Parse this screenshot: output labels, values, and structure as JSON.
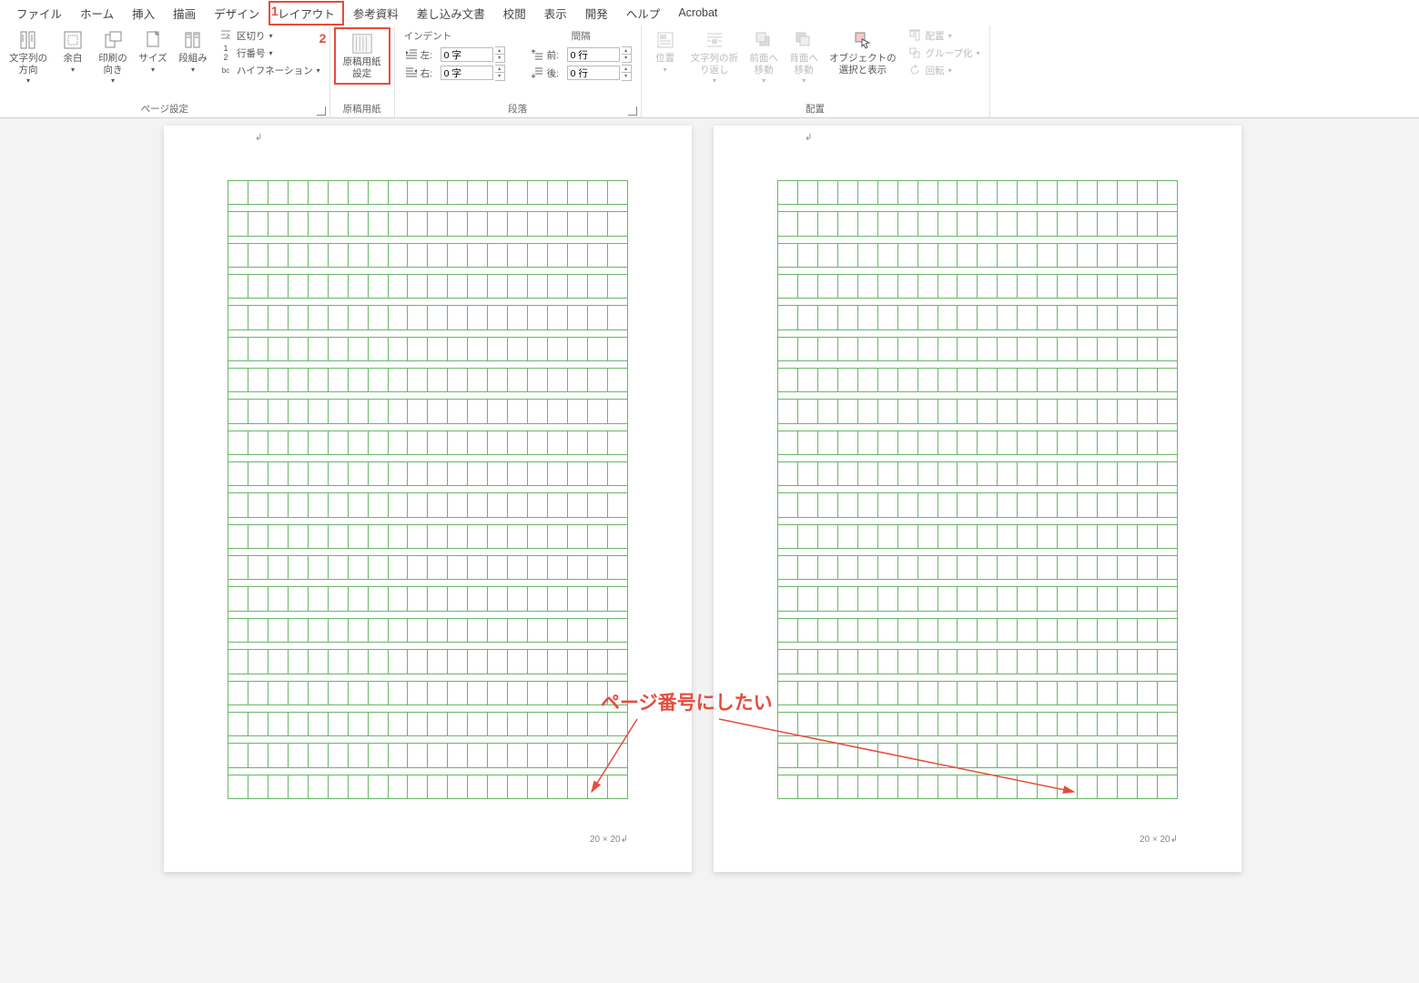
{
  "menu": {
    "file": "ファイル",
    "home": "ホーム",
    "insert": "挿入",
    "draw": "描画",
    "design": "デザイン",
    "layout": "レイアウト",
    "references": "参考資料",
    "mailings": "差し込み文書",
    "review": "校閲",
    "view": "表示",
    "developer": "開発",
    "help": "ヘルプ",
    "acrobat": "Acrobat"
  },
  "callouts": {
    "one": "1",
    "two": "2"
  },
  "ribbon": {
    "page_setup": {
      "label": "ページ設定",
      "text_direction": "文字列の\n方向",
      "margins": "余白",
      "orientation": "印刷の\n向き",
      "size": "サイズ",
      "columns": "段組み",
      "breaks": "区切り",
      "line_numbers": "行番号",
      "hyphenation": "ハイフネーション"
    },
    "genko": {
      "label": "原稿用紙",
      "button": "原稿用紙\n設定"
    },
    "paragraph": {
      "label": "段落",
      "indent_header": "インデント",
      "spacing_header": "間隔",
      "left_label": "左:",
      "right_label": "右:",
      "before_label": "前:",
      "after_label": "後:",
      "left_value": "0 字",
      "right_value": "0 字",
      "before_value": "0 行",
      "after_value": "0 行"
    },
    "arrange": {
      "label": "配置",
      "position": "位置",
      "wrap": "文字列の折\nり返し",
      "bring_forward": "前面へ\n移動",
      "send_backward": "背面へ\n移動",
      "selection_pane": "オブジェクトの\n選択と表示",
      "align": "配置",
      "group": "グループ化",
      "rotate": "回転"
    }
  },
  "page": {
    "footer": "20 × 20"
  },
  "annotation": {
    "text": "ページ番号にしたい"
  }
}
